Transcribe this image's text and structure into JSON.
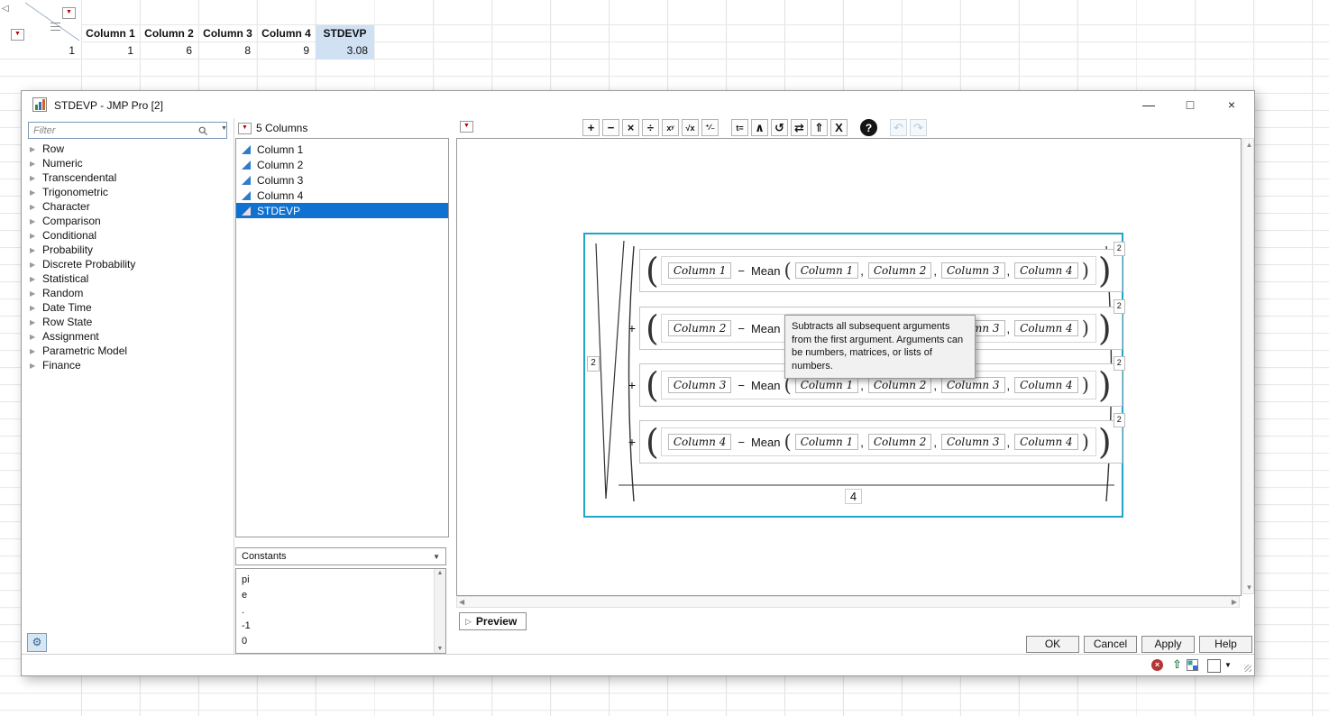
{
  "spreadsheet": {
    "columns": [
      "Column 1",
      "Column 2",
      "Column 3",
      "Column 4",
      "STDEVP"
    ],
    "row_number": "1",
    "values": [
      "1",
      "6",
      "8",
      "9",
      "3.08"
    ],
    "highlight_color": "#cfe1f3"
  },
  "window": {
    "title": "STDEVP - JMP Pro [2]",
    "minimize": "—",
    "maximize": "□",
    "close": "×"
  },
  "filter": {
    "placeholder": "Filter"
  },
  "categories": [
    "Row",
    "Numeric",
    "Transcendental",
    "Trigonometric",
    "Character",
    "Comparison",
    "Conditional",
    "Probability",
    "Discrete Probability",
    "Statistical",
    "Random",
    "Date Time",
    "Row State",
    "Assignment",
    "Parametric Model",
    "Finance"
  ],
  "columns_panel": {
    "header": "5 Columns",
    "items": [
      "Column 1",
      "Column 2",
      "Column 3",
      "Column 4",
      "STDEVP"
    ]
  },
  "constants": {
    "label": "Constants",
    "items": [
      "pi",
      "e",
      ".",
      "-1",
      "0"
    ]
  },
  "toolbar": {
    "buttons": [
      {
        "name": "add",
        "glyph": "+"
      },
      {
        "name": "subtract",
        "glyph": "−"
      },
      {
        "name": "multiply",
        "glyph": "×"
      },
      {
        "name": "divide",
        "glyph": "÷"
      },
      {
        "name": "power",
        "glyph": "xʸ"
      },
      {
        "name": "root",
        "glyph": "√x"
      },
      {
        "name": "sign-toggle",
        "glyph": "⁺∕₋"
      },
      {
        "name": "local-variable",
        "glyph": "t="
      },
      {
        "name": "insert",
        "glyph": "∧"
      },
      {
        "name": "dynamic-reference",
        "glyph": "↺"
      },
      {
        "name": "switch-terms",
        "glyph": "⇄"
      },
      {
        "name": "peel-expression",
        "glyph": "⇑"
      },
      {
        "name": "delete",
        "glyph": "X"
      },
      {
        "name": "help",
        "glyph": "?"
      },
      {
        "name": "undo",
        "glyph": "↶"
      },
      {
        "name": "redo",
        "glyph": "↷"
      }
    ]
  },
  "formula": {
    "root_index": "2",
    "open_paren": "(",
    "close_paren": ")",
    "comma": ",",
    "plus_op": "+",
    "minus_op": "−",
    "mean_label": "Mean",
    "exponent": "2",
    "denominator": "4",
    "terms": [
      {
        "minuend": "Column 1"
      },
      {
        "minuend": "Column 2"
      },
      {
        "minuend": "Column 3"
      },
      {
        "minuend": "Column 4"
      }
    ],
    "mean_args": [
      "Column 1",
      "Column 2",
      "Column 3",
      "Column 4"
    ]
  },
  "tooltip": {
    "text": "Subtracts all subsequent arguments from the first argument. Arguments can be numbers, matrices, or lists of numbers."
  },
  "preview": {
    "label": "Preview"
  },
  "dialog_buttons": {
    "ok": "OK",
    "cancel": "Cancel",
    "apply": "Apply",
    "help": "Help"
  },
  "icons": {
    "red_triangle": "▼",
    "disclosure": "▶",
    "disclosure_open": "▷",
    "dropdown": "▼",
    "scroll_up": "▲",
    "scroll_down": "▼",
    "scroll_left": "◀",
    "scroll_right": "▶",
    "gear": "⚙",
    "collapse": "◁",
    "status_clear": "×",
    "status_up": "⇧",
    "status_dropdown": "▼"
  }
}
